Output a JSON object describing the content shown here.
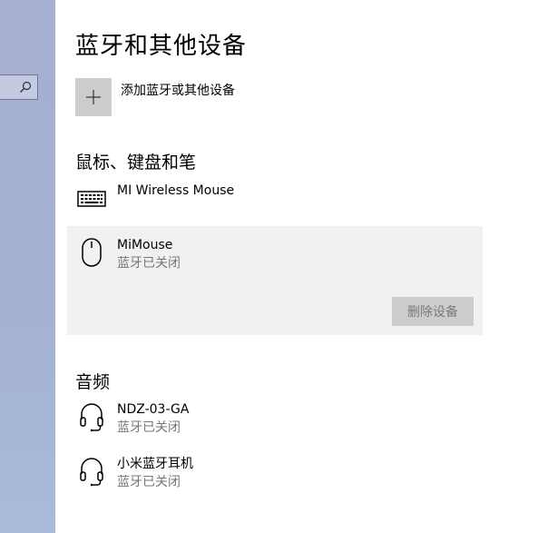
{
  "page": {
    "title": "蓝牙和其他设备",
    "add_device_label": "添加蓝牙或其他设备"
  },
  "sections": {
    "input": {
      "title": "鼠标、键盘和笔",
      "devices": [
        {
          "name": "MI Wireless Mouse",
          "icon": "keyboard-icon"
        },
        {
          "name": "MiMouse",
          "status": "蓝牙已关闭",
          "icon": "mouse-icon",
          "selected": true
        }
      ],
      "remove_button_label": "删除设备"
    },
    "audio": {
      "title": "音频",
      "devices": [
        {
          "name": "NDZ-03-GA",
          "status": "蓝牙已关闭",
          "icon": "headset-icon"
        },
        {
          "name": "小米蓝牙耳机",
          "status": "蓝牙已关闭",
          "icon": "headset-icon"
        }
      ]
    }
  },
  "colors": {
    "sidebar": "#a6aed1",
    "tile": "#cccccc",
    "selected_bg": "#f1f1f1",
    "status_text": "#767676"
  }
}
